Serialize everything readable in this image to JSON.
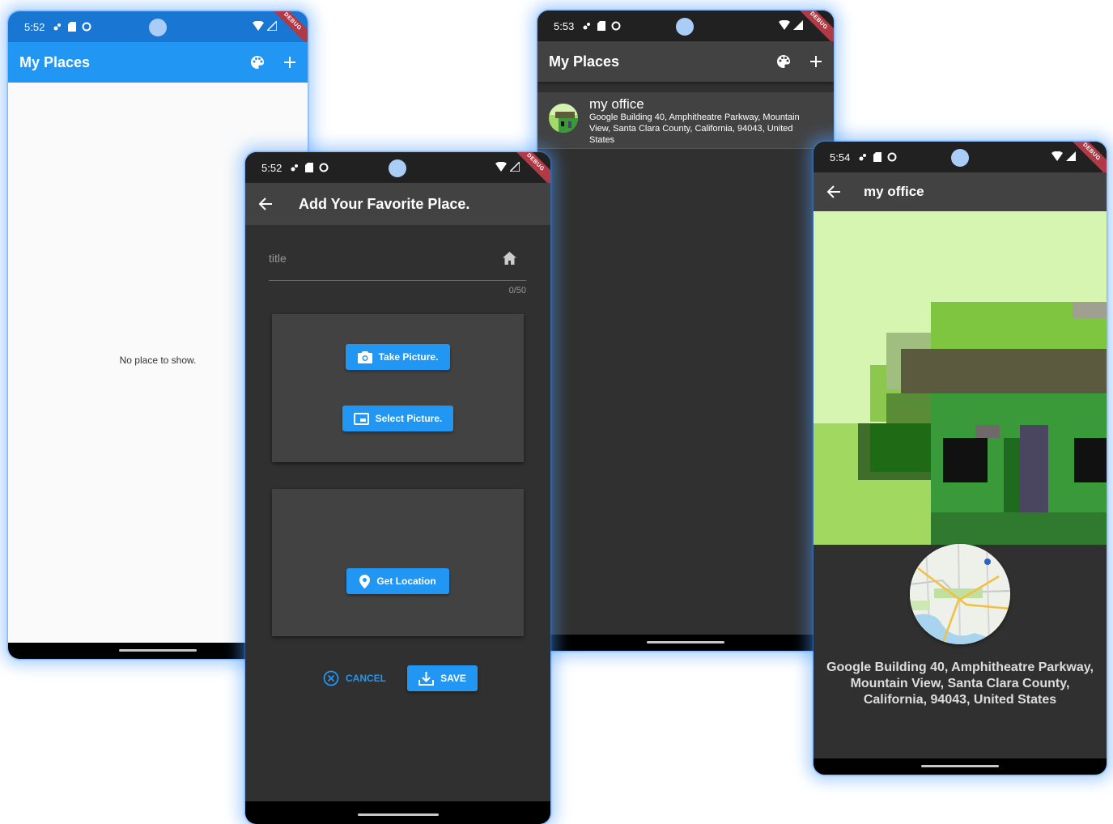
{
  "status": {
    "time_a": "5:52",
    "time_b": "5:52",
    "time_c": "5:53",
    "time_d": "5:54",
    "debug_label": "DEBUG"
  },
  "screen_home_empty": {
    "title": "My Places",
    "empty_message": "No place to show.",
    "appbar_color": "#2196f3",
    "background": "#fafafa"
  },
  "screen_add": {
    "title": "Add Your Favorite Place.",
    "title_placeholder": "title",
    "char_counter": "0/50",
    "take_picture_label": "Take Picture.",
    "select_picture_label": "Select Picture.",
    "get_location_label": "Get Location",
    "cancel_label": "CANCEL",
    "save_label": "SAVE"
  },
  "screen_list": {
    "title": "My Places",
    "items": [
      {
        "title": "my office",
        "address": "Google Building 40, Amphitheatre Parkway, Mountain View, Santa Clara County, California, 94043, United States"
      }
    ]
  },
  "screen_detail": {
    "title": "my office",
    "address": "Google Building 40, Amphitheatre Parkway, Mountain View, Santa Clara County, California, 94043, United States"
  },
  "colors": {
    "accent": "#2196f3",
    "dark_bg": "#303030",
    "dark_appbar": "#424242",
    "dark_card": "#424242"
  },
  "icons": {
    "palette": "palette-icon",
    "add": "plus-icon",
    "back": "arrow-back-icon",
    "home": "home-icon",
    "camera": "camera-icon",
    "gallery": "picture-icon",
    "location": "location-pin-icon",
    "cancel": "cancel-circle-icon",
    "save": "download-icon"
  }
}
